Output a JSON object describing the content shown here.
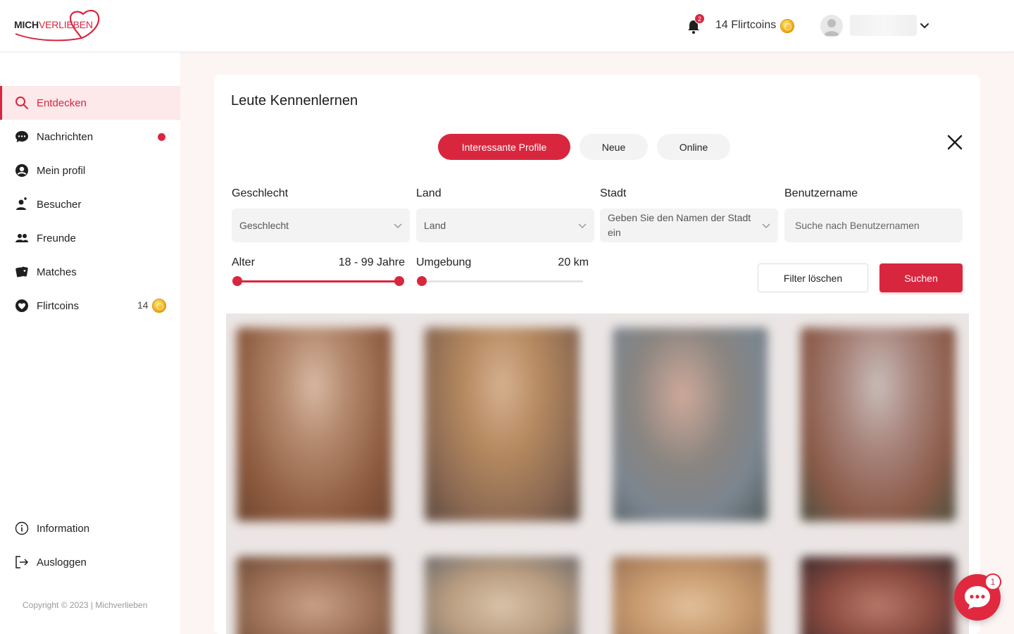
{
  "brand": {
    "logo_part1": "MICH",
    "logo_part2": "VERLIEBEN",
    "accent_color": "#d9263f"
  },
  "header": {
    "notification_count": "2",
    "flirtcoins_label": "14 Flirtcoins"
  },
  "sidebar": {
    "items": [
      {
        "label": "Entdecken",
        "icon": "search-icon"
      },
      {
        "label": "Nachrichten",
        "icon": "chat-icon"
      },
      {
        "label": "Mein profil",
        "icon": "user-circle-icon"
      },
      {
        "label": "Besucher",
        "icon": "visitor-icon"
      },
      {
        "label": "Freunde",
        "icon": "friends-icon"
      },
      {
        "label": "Matches",
        "icon": "matches-icon"
      },
      {
        "label": "Flirtcoins",
        "icon": "heart-coin-icon",
        "count": "14"
      }
    ],
    "bottom": [
      {
        "label": "Information",
        "icon": "info-icon"
      },
      {
        "label": "Ausloggen",
        "icon": "logout-icon"
      }
    ],
    "copyright": "Copyright © 2023 | Michverlieben"
  },
  "main": {
    "title": "Leute Kennenlernen",
    "tabs": [
      {
        "label": "Interessante Profile",
        "active": true
      },
      {
        "label": "Neue",
        "active": false
      },
      {
        "label": "Online",
        "active": false
      }
    ],
    "filters": {
      "gender": {
        "label": "Geschlecht",
        "value": "Geschlecht"
      },
      "country": {
        "label": "Land",
        "value": "Land"
      },
      "city": {
        "label": "Stadt",
        "placeholder": "Geben Sie den Namen der Stadt ein"
      },
      "username": {
        "label": "Benutzername",
        "placeholder": "Suche nach Benutzernamen"
      },
      "age": {
        "label": "Alter",
        "value": "18 - 99 Jahre"
      },
      "radius": {
        "label": "Umgebung",
        "value": "20 km"
      }
    },
    "buttons": {
      "clear": "Filter löschen",
      "search": "Suchen"
    }
  },
  "chat_widget": {
    "badge": "1"
  }
}
